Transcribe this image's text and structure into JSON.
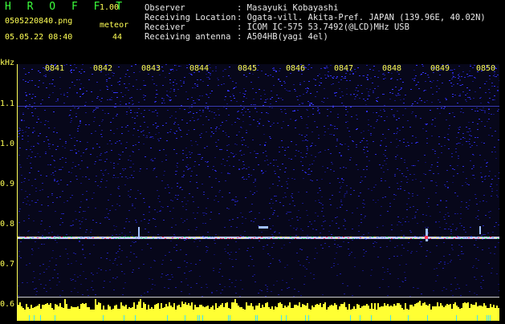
{
  "app": {
    "logo": "H R O F F T",
    "version": "1.00"
  },
  "file": {
    "name": "0505220840.png",
    "datetime": "05.05.22 08:40"
  },
  "meteor": {
    "label": "meteor",
    "count": "44"
  },
  "info": [
    {
      "key": "Observer",
      "value": ": Masayuki Kobayashi"
    },
    {
      "key": "Receiving Location",
      "value": ": Ogata-vill. Akita-Pref. JAPAN (139.96E, 40.02N)"
    },
    {
      "key": "Receiver",
      "value": ": ICOM IC-575 53.7492(@LCD)MHz USB"
    },
    {
      "key": "Receiving antenna",
      "value": ": A504HB(yagi 4el)"
    }
  ],
  "plot": {
    "y_unit": "kHz",
    "y_ticks": [
      "1.1",
      "1.0",
      "0.9",
      "0.8",
      "0.7",
      "0.6"
    ],
    "time_ticks": [
      "0841",
      "0842",
      "0843",
      "0844",
      "0845",
      "0846",
      "0847",
      "0848",
      "0849",
      "0850"
    ]
  },
  "colors": {
    "label": "#ffff55",
    "logo": "#3cff3c",
    "background": "#000000",
    "noise": "#2a2aa8",
    "meteor_line": "#ff4060"
  }
}
